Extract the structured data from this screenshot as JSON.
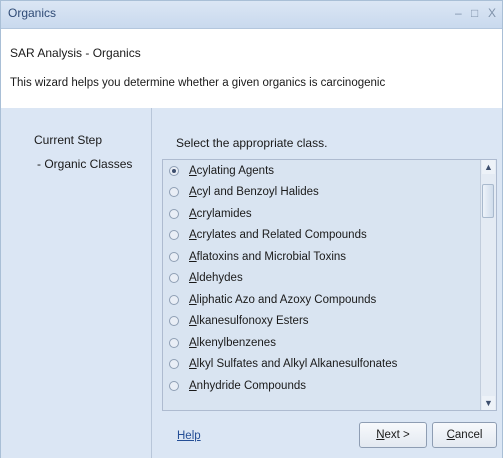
{
  "window": {
    "title": "Organics",
    "controls": {
      "minimize": "–",
      "maximize": "□",
      "close": "X"
    }
  },
  "header": {
    "title": "SAR Analysis - Organics",
    "description": "This wizard helps you determine whether a given organics is carcinogenic"
  },
  "sidebar": {
    "heading": "Current Step",
    "item": "- Organic Classes"
  },
  "main": {
    "instruction": "Select the appropriate class.",
    "selected_index": 0,
    "options": [
      {
        "access": "A",
        "rest": "cylating Agents"
      },
      {
        "access": "A",
        "rest": "cyl and Benzoyl Halides"
      },
      {
        "access": "A",
        "rest": "crylamides"
      },
      {
        "access": "A",
        "rest": "crylates and Related Compounds"
      },
      {
        "access": "A",
        "rest": "flatoxins and Microbial Toxins"
      },
      {
        "access": "A",
        "rest": "ldehydes"
      },
      {
        "access": "A",
        "rest": "liphatic Azo and Azoxy Compounds"
      },
      {
        "access": "A",
        "rest": "lkanesulfonoxy Esters"
      },
      {
        "access": "A",
        "rest": "lkenylbenzenes"
      },
      {
        "access": "A",
        "rest": "lkyl Sulfates and Alkyl Alkanesulfonates"
      },
      {
        "access": "A",
        "rest": "nhydride Compounds"
      }
    ]
  },
  "footer": {
    "help": "Help",
    "next": {
      "access": "N",
      "rest": "ext >"
    },
    "cancel": {
      "access": "C",
      "rest": "ancel"
    }
  },
  "icons": {
    "scroll_up": "▲",
    "scroll_down": "▼"
  }
}
